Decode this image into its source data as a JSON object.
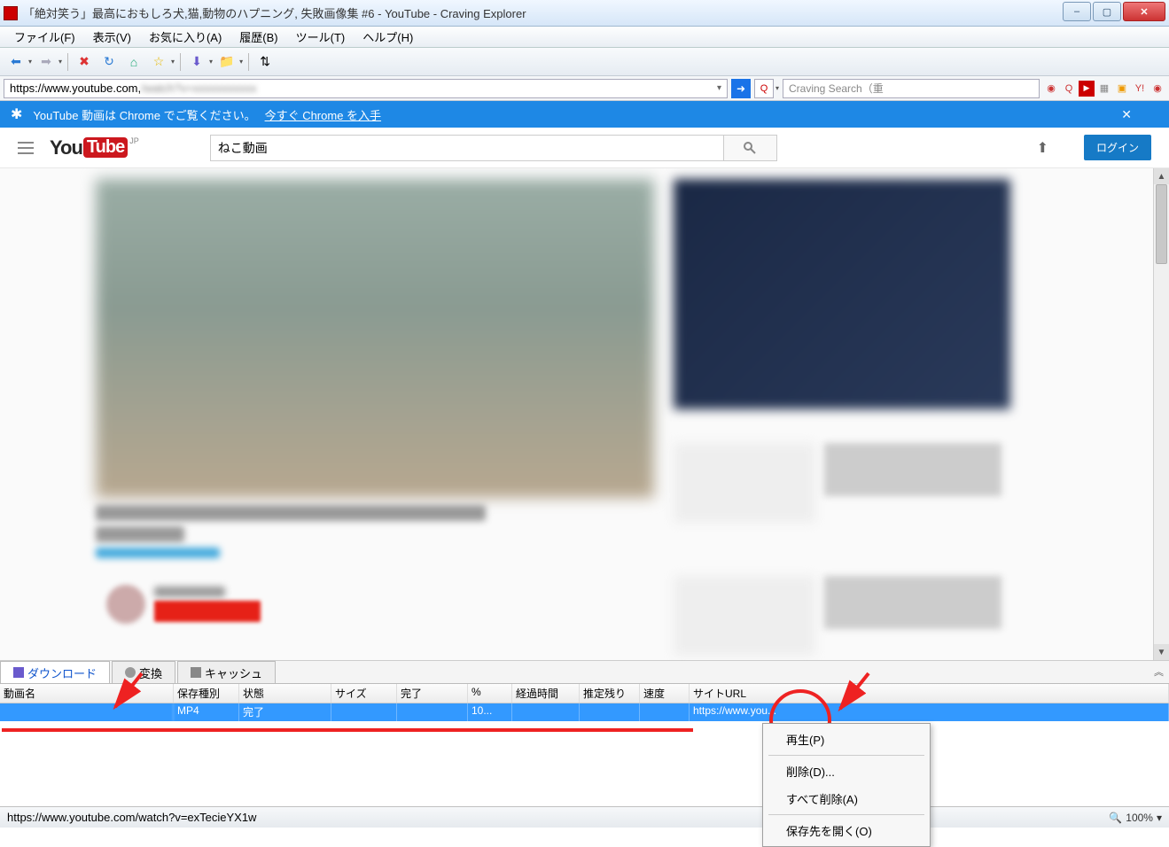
{
  "window": {
    "title": "「絶対笑う」最高におもしろ犬,猫,動物のハプニング, 失敗画像集 #6 - YouTube - Craving Explorer",
    "minimize": "–",
    "maximize": "▢",
    "close": "✕"
  },
  "menubar": {
    "file": "ファイル(F)",
    "view": "表示(V)",
    "favorites": "お気に入り(A)",
    "history": "履歴(B)",
    "tools": "ツール(T)",
    "help": "ヘルプ(H)"
  },
  "toolbar": {
    "back": "⬅",
    "forward": "➡",
    "stop": "✖",
    "reload": "↻",
    "home": "⌂",
    "favorites": "☆",
    "download": "⬇",
    "folder": "📁",
    "settings": "⇅"
  },
  "addressbar": {
    "url": "https://www.youtube.com,",
    "dropdown": "▾",
    "go": "➜",
    "search_placeholder": "Craving Search（重"
  },
  "chrome_notice": {
    "text": "YouTube 動画は Chrome でご覧ください。",
    "link": "今すぐ Chrome を入手",
    "close": "✕"
  },
  "youtube": {
    "logo_you": "You",
    "logo_tube": "Tube",
    "jp": "JP",
    "search_value": "ねこ動画",
    "upload": "⬆",
    "login": "ログイン"
  },
  "download_panel": {
    "tabs": {
      "download": "ダウンロード",
      "convert": "変換",
      "cache": "キャッシュ"
    },
    "columns": {
      "name": "動画名",
      "type": "保存種別",
      "state": "状態",
      "size": "サイズ",
      "done": "完了",
      "percent": "%",
      "elapsed": "経過時間",
      "remain": "推定残り",
      "speed": "速度",
      "url": "サイトURL"
    },
    "row": {
      "name": "",
      "type": "MP4",
      "state": "完了",
      "size": "",
      "done": "",
      "percent": "10...",
      "elapsed": "",
      "remain": "",
      "speed": "",
      "url": "https://www.you..."
    }
  },
  "context_menu": {
    "play": "再生(P)",
    "delete": "削除(D)...",
    "delete_all": "すべて削除(A)",
    "open_folder": "保存先を開く(O)"
  },
  "statusbar": {
    "url": "https://www.youtube.com/watch?v=exTecieYX1w",
    "zoom": "100%"
  }
}
